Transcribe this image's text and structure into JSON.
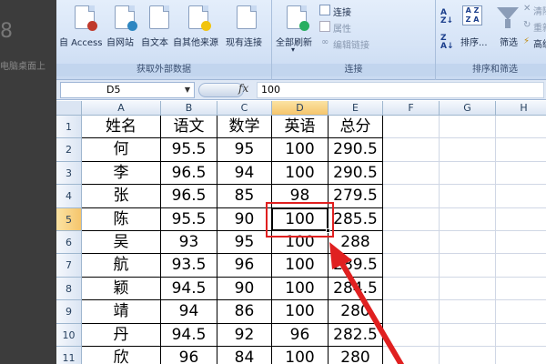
{
  "background": {
    "number": "8",
    "text": "电脑桌面上"
  },
  "ribbon": {
    "groups": [
      {
        "label": "获取外部数据",
        "buttons": [
          "自 Access",
          "自网站",
          "自文本",
          "自其他来源",
          "现有连接"
        ]
      },
      {
        "label": "连接",
        "buttons": [
          "全部刷新",
          "连接",
          "属性",
          "编辑链接"
        ]
      },
      {
        "label": "排序和筛选",
        "buttons": [
          "排序...",
          "筛选",
          "清除",
          "重新应用",
          "高级"
        ]
      }
    ]
  },
  "formula_bar": {
    "name_box": "D5",
    "fx": "fx",
    "value": "100"
  },
  "sheet": {
    "columns": [
      "A",
      "B",
      "C",
      "D",
      "E",
      "F",
      "G",
      "H"
    ],
    "rows": [
      "1",
      "2",
      "3",
      "4",
      "5",
      "6",
      "7",
      "8",
      "9",
      "10",
      "11"
    ],
    "headers": [
      "姓名",
      "语文",
      "数学",
      "英语",
      "总分"
    ],
    "data": [
      [
        "何",
        "95.5",
        "95",
        "100",
        "290.5"
      ],
      [
        "李",
        "96.5",
        "94",
        "100",
        "290.5"
      ],
      [
        "张",
        "96.5",
        "85",
        "98",
        "279.5"
      ],
      [
        "陈",
        "95.5",
        "90",
        "100",
        "285.5"
      ],
      [
        "吴",
        "93",
        "95",
        "100",
        "288"
      ],
      [
        "航",
        "93.5",
        "96",
        "100",
        "289.5"
      ],
      [
        "颖",
        "94.5",
        "90",
        "100",
        "284.5"
      ],
      [
        "靖",
        "94",
        "86",
        "100",
        "280"
      ],
      [
        "丹",
        "94.5",
        "92",
        "96",
        "282.5"
      ],
      [
        "欣",
        "96",
        "84",
        "100",
        "280"
      ]
    ],
    "active_cell": "D5"
  },
  "colors": {
    "highlight": "#e02020",
    "selected_header": "#f5c56c"
  }
}
